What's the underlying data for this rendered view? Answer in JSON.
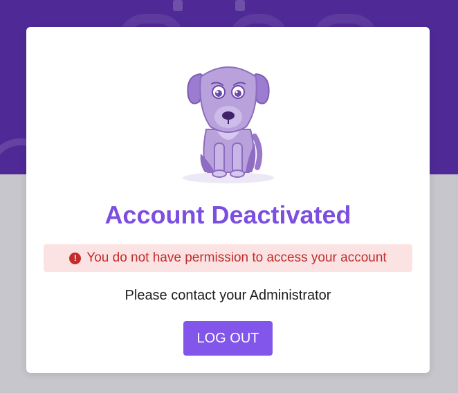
{
  "modal": {
    "title": "Account Deactivated",
    "alert_message": "You do not have permission to access your account",
    "subtext": "Please contact your Administrator",
    "logout_label": "LOG OUT",
    "illustration": "sad-dog-illustration",
    "alert_icon": "exclamation-circle-icon"
  },
  "colors": {
    "backdrop_top": "#4f2a96",
    "backdrop_bottom": "#c7c6cc",
    "title": "#7c4fe0",
    "alert_background": "#fbe3e3",
    "alert_text": "#c22c2c",
    "button": "#8256ea"
  }
}
